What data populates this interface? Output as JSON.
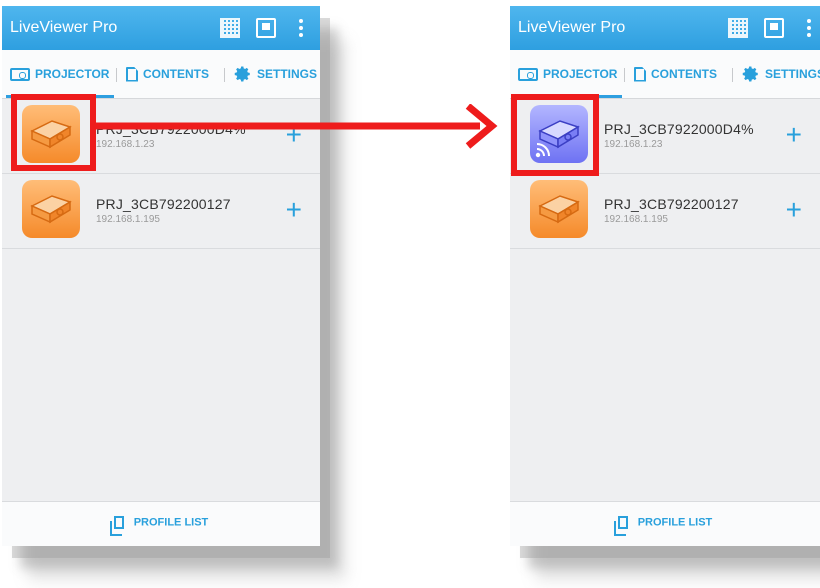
{
  "app": {
    "title": "LiveViewer Pro"
  },
  "icons": {
    "qr": "qr-code-icon",
    "download": "download-icon",
    "menu": "overflow-menu-icon",
    "projector": "projector-icon",
    "contents": "document-icon",
    "settings": "gear-icon",
    "profile": "copy-icon",
    "add": "plus-icon"
  },
  "tabs": [
    {
      "label": "PROJECTOR"
    },
    {
      "label": "CONTENTS"
    },
    {
      "label": "SETTINGS"
    }
  ],
  "projectors": [
    {
      "name": "PRJ_3CB7922000D4%",
      "ip": "192.168.1.23"
    },
    {
      "name": "PRJ_3CB792200127",
      "ip": "192.168.1.195"
    }
  ],
  "footer": {
    "label": "PROFILE LIST"
  },
  "colors": {
    "accent": "#29a0dc",
    "appbar": "#2e9fe0",
    "highlight": "#ee1c1c",
    "orange_icon": "#f58a2a",
    "blue_icon": "#6e72f3"
  }
}
